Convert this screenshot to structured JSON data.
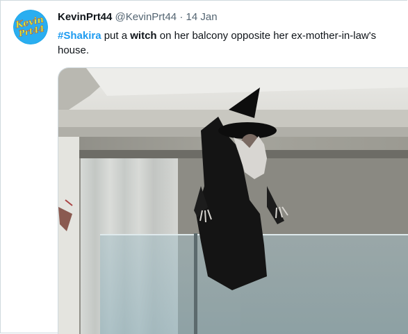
{
  "tweet": {
    "avatar_text_line1": "Kevin",
    "avatar_text_line2": "Prt44",
    "display_name": "KevinPrt44",
    "handle": "@KevinPrt44",
    "separator": " · ",
    "date": "14 Jan",
    "text": {
      "hashtag": "#Shakira",
      "part1": " put a ",
      "bold_word": "witch",
      "part2": " on her balcony opposite her ex-mother-in-law's house."
    },
    "media": {
      "description_icon": "photo-witch-on-balcony"
    }
  },
  "colors": {
    "link": "#1d9bf0",
    "text": "#0f1419",
    "secondary": "#536471",
    "avatar_bg": "#1da1f2",
    "avatar_text": "#d9f53a"
  }
}
